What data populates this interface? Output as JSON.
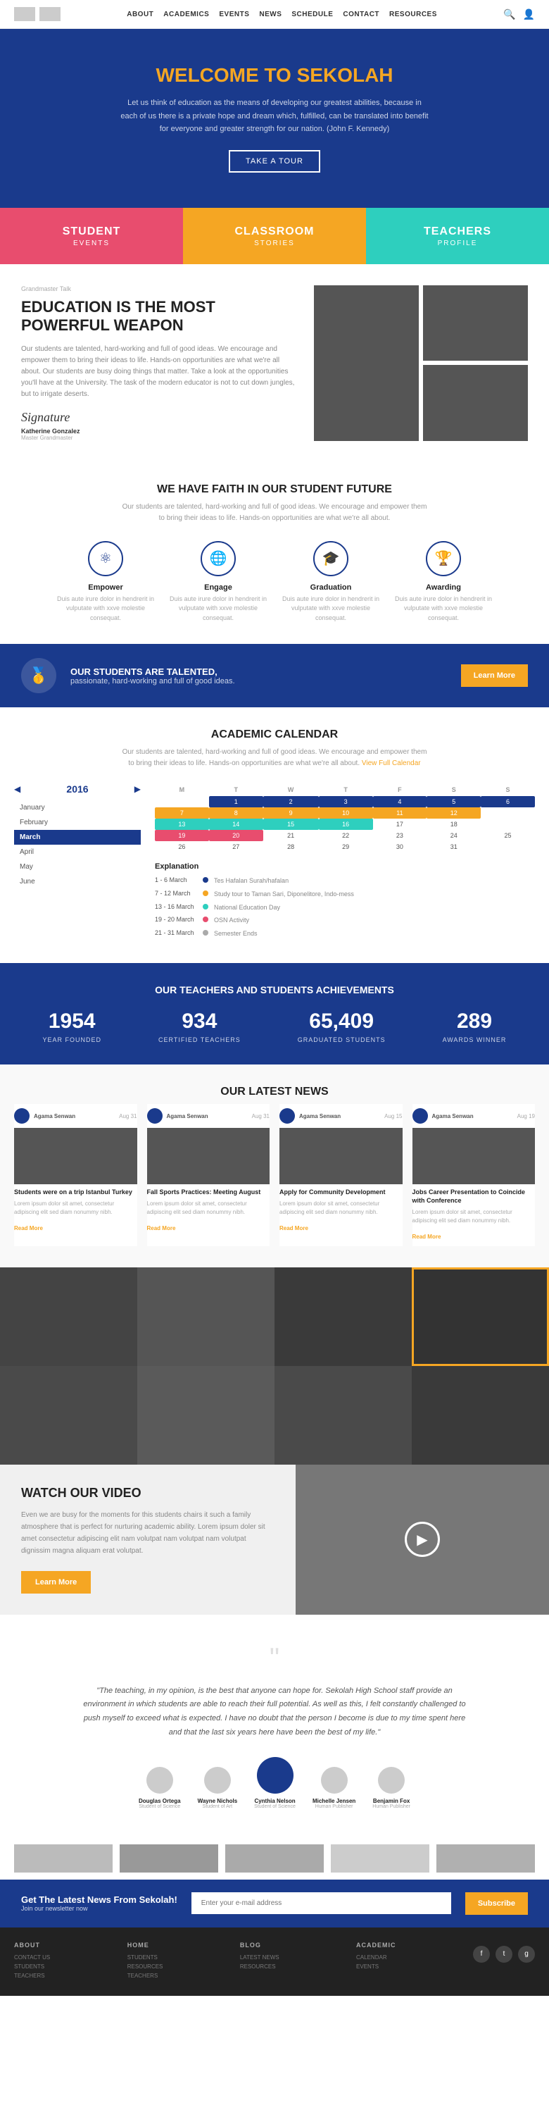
{
  "header": {
    "nav_items": [
      "ABOUT",
      "ACADEMICS",
      "EVENTS",
      "NEWS",
      "SCHEDULE",
      "CONTACT",
      "RESOURCES"
    ]
  },
  "hero": {
    "title_prefix": "WELCOME TO ",
    "title_brand": "SEKOLAH",
    "subtitle": "Let us think of education as the means of developing our greatest abilities, because in each of us there is a private hope and dream which, fulfilled, can be translated into benefit for everyone and greater strength for our nation. (John F. Kennedy)",
    "cta": "TAKE A TOUR"
  },
  "color_tabs": [
    {
      "title": "STUDENT",
      "sub": "EVENTS",
      "color": "red"
    },
    {
      "title": "CLASSROOM",
      "sub": "STORIES",
      "color": "orange"
    },
    {
      "title": "TEACHERS",
      "sub": "PROFILE",
      "color": "teal"
    }
  ],
  "article": {
    "tag": "Grandmaster Talk",
    "title": "EDUCATION IS THE MOST POWERFUL WEAPON",
    "body": "Our students are talented, hard-working and full of good ideas. We encourage and empower them to bring their ideas to life. Hands-on opportunities are what we're all about. Our students are busy doing things that matter. Take a look at the opportunities you'll have at the University. The task of the modern educator is not to cut down jungles, but to irrigate deserts.",
    "signature": "Signature",
    "author": "Katherine Gonzalez",
    "role": "Master Grandmaster"
  },
  "faith": {
    "title": "WE HAVE FAITH IN OUR STUDENT FUTURE",
    "sub": "Our students are talented, hard-working and full of good ideas. We encourage and empower them to bring their ideas to life. Hands-on opportunities are what we're all about.",
    "items": [
      {
        "icon": "⚛",
        "title": "Empower",
        "text": "Duis aute irure dolor in hendrerit in vulputate with xxve molestie consequat."
      },
      {
        "icon": "🌐",
        "title": "Engage",
        "text": "Duis aute irure dolor in hendrerit in vulputate with xxve molestie consequat."
      },
      {
        "icon": "🎓",
        "title": "Graduation",
        "text": "Duis aute irure dolor in hendrerit in vulputate with xxve molestie consequat."
      },
      {
        "icon": "🏆",
        "title": "Awarding",
        "text": "Duis aute irure dolor in hendrerit in vulputate with xxve molestie consequat."
      }
    ]
  },
  "banner": {
    "icon": "🥇",
    "bold": "OUR STUDENTS ARE TALENTED,",
    "normal": "passionate, hard-working and full of good ideas.",
    "btn": "Learn More"
  },
  "calendar": {
    "section_title": "ACADEMIC CALENDAR",
    "section_sub": "Our students are talented, hard-working and full of good ideas. We encourage and empower them to bring their ideas to life. Hands-on opportunities are what we're all about.",
    "view_full": "View Full Calendar",
    "year": "2016",
    "months": [
      "January",
      "February",
      "March",
      "April",
      "May",
      "June"
    ],
    "active_month": "March",
    "days_header": [
      "M",
      "T",
      "W",
      "T",
      "F",
      "S",
      "S"
    ],
    "explanation": {
      "title": "Explanation",
      "items": [
        {
          "date": "1 - 6 March",
          "color": "#1a3a8c",
          "text": "Tes Hafalan Surah/hafalan"
        },
        {
          "date": "7 - 12 March",
          "color": "#f5a623",
          "text": "Study tour to Taman Sari, Diponelitore, Indo-mess"
        },
        {
          "date": "13 - 16 March",
          "color": "#2ecfbe",
          "text": "National Education Day"
        },
        {
          "date": "19 - 20 March",
          "color": "#e84d6e",
          "text": "OSN Activity"
        },
        {
          "date": "21 - 31 March",
          "color": "#aaa",
          "text": "Semester Ends"
        }
      ]
    }
  },
  "achievements": {
    "title": "OUR TEACHERS AND STUDENTS ACHIEVEMENTS",
    "stats": [
      {
        "number": "1954",
        "label": "YEAR FOUNDED"
      },
      {
        "number": "934",
        "label": "CERTIFIED TEACHERS"
      },
      {
        "number": "65,409",
        "label": "GRADUATED STUDENTS"
      },
      {
        "number": "289",
        "label": "AWARDS WINNER"
      }
    ]
  },
  "news": {
    "title": "OUR LATEST NEWS",
    "cards": [
      {
        "author": "Agama Senwan",
        "date": "Aug 31",
        "title": "Students were on a trip Istanbul Turkey",
        "text": "Lorem ipsum dolor sit amet, consectetur adipiscing elit sed diam nonummy nibh.",
        "read_more": "Read More"
      },
      {
        "author": "Agama Senwan",
        "date": "Aug 31",
        "title": "Fall Sports Practices: Meeting August",
        "text": "Lorem ipsum dolor sit amet, consectetur adipiscing elit sed diam nonummy nibh.",
        "read_more": "Read More"
      },
      {
        "author": "Agama Senwan",
        "date": "Aug 15",
        "title": "Apply for Community Development",
        "text": "Lorem ipsum dolor sit amet, consectetur adipiscing elit sed diam nonummy nibh.",
        "read_more": "Read More"
      },
      {
        "author": "Agama Senwan",
        "date": "Aug 19",
        "title": "Jobs Career Presentation to Coincide with Conference",
        "text": "Lorem ipsum dolor sit amet, consectetur adipiscing elit sed diam nonummy nibh.",
        "read_more": "Read More"
      }
    ]
  },
  "video": {
    "title": "WATCH OUR VIDEO",
    "body": "Even we are busy for the moments for this students chairs it such a family atmosphere that is perfect for nurturing academic ability. Lorem ipsum doler sit amet consectetur adipiscing elit nam volutpat nam volutpat nam volutpat dignissim magna aliquam erat volutpat.",
    "learn_more": "Learn More"
  },
  "testimonial": {
    "quote": "\"The teaching, in my opinion, is the best that anyone can hope for. Sekolah High School staff provide an environment in which students are able to reach their full potential. As well as this, I felt constantly challenged to push myself to exceed what is expected. I have no doubt that the person I become is due to my time spent here and that the last six years here have been the best of my life.\"",
    "avatars": [
      {
        "name": "Douglas Ortega",
        "role": "Student of Science"
      },
      {
        "name": "Wayne Nichols",
        "role": "Student of Art"
      },
      {
        "name": "Cynthia Nelson",
        "role": "Student of Science",
        "active": true
      },
      {
        "name": "Michelle Jensen",
        "role": "Human Publisher"
      },
      {
        "name": "Benjamin Fox",
        "role": "Human Publisher"
      }
    ]
  },
  "newsletter": {
    "title": "Get The Latest News From Sekolah!",
    "sub": "Join our newsletter now",
    "placeholder": "Enter your e-mail address",
    "btn": "Subscribe"
  },
  "footer": {
    "cols": [
      {
        "title": "ABOUT",
        "links": [
          "CONTACT US",
          "STUDENTS",
          "TEACHERS"
        ]
      },
      {
        "title": "HOME",
        "links": [
          "STUDENTS",
          "RESOURCES",
          "TEACHERS"
        ]
      },
      {
        "title": "BLOG",
        "links": [
          "LATEST NEWS",
          "RESOURCES"
        ]
      },
      {
        "title": "ACADEMIC",
        "links": [
          "CALENDAR",
          "EVENTS"
        ]
      }
    ],
    "social": [
      "f",
      "t",
      "g"
    ]
  }
}
